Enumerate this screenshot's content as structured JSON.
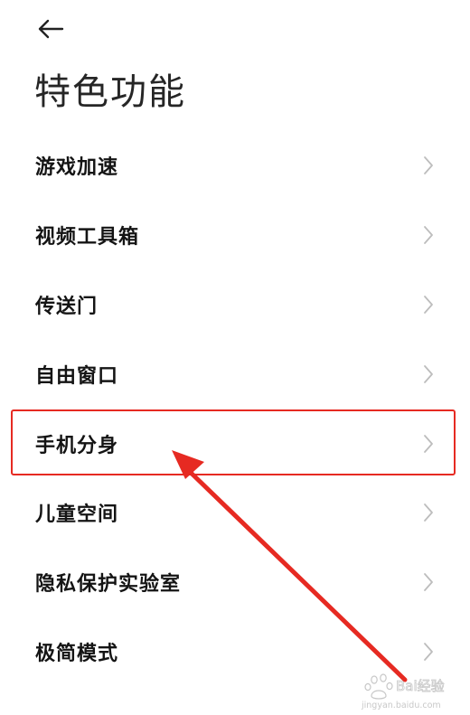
{
  "header": {
    "back_icon": "arrow-left-icon",
    "title": "特色功能"
  },
  "menu": {
    "items": [
      {
        "label": "游戏加速"
      },
      {
        "label": "视频工具箱"
      },
      {
        "label": "传送门"
      },
      {
        "label": "自由窗口"
      },
      {
        "label": "手机分身"
      },
      {
        "label": "儿童空间"
      },
      {
        "label": "隐私保护实验室"
      },
      {
        "label": "极简模式"
      }
    ],
    "chevron_icon": "chevron-right-icon"
  },
  "annotation": {
    "highlight_color": "#e62a22",
    "highlighted_item": "手机分身"
  },
  "watermark": {
    "text": "Bai经验",
    "subtext": "jingyan.baidu.com"
  }
}
